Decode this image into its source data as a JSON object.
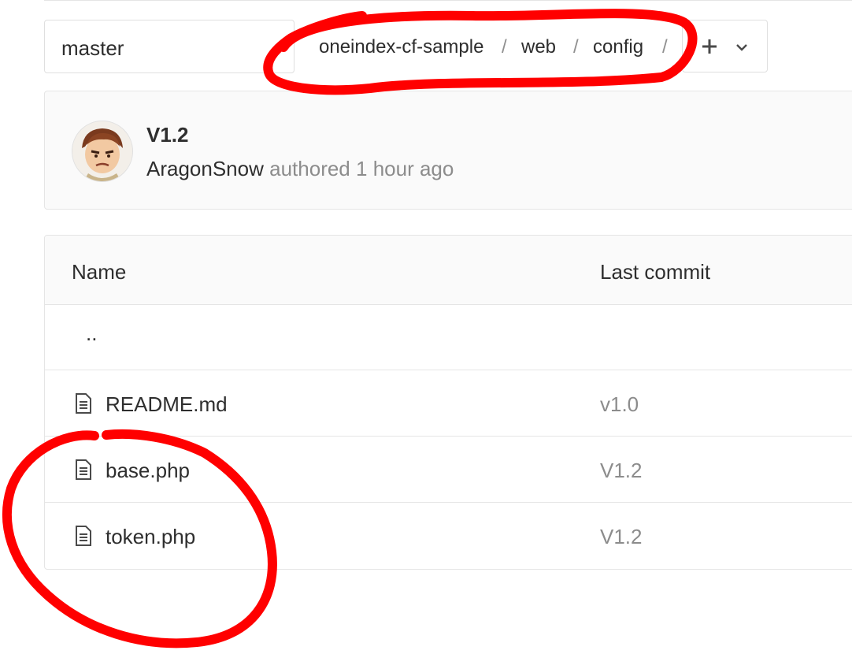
{
  "branch": {
    "name": "master"
  },
  "breadcrumb": {
    "items": [
      "oneindex-cf-sample",
      "web",
      "config"
    ],
    "separator": "/"
  },
  "add_menu": {
    "icon": "plus-icon",
    "chevron": "chevron-down-icon"
  },
  "last_commit": {
    "title": "V1.2",
    "author": "AragonSnow",
    "action": "authored",
    "time": "1 hour ago",
    "avatar_icon": "avatar"
  },
  "table": {
    "headers": {
      "name": "Name",
      "last_commit": "Last commit"
    },
    "parent_dir": "..",
    "files": [
      {
        "name": "README.md",
        "commit": "v1.0",
        "icon": "file-icon"
      },
      {
        "name": "base.php",
        "commit": "V1.2",
        "icon": "file-icon"
      },
      {
        "name": "token.php",
        "commit": "V1.2",
        "icon": "file-icon"
      }
    ]
  },
  "colors": {
    "annotation": "#ff0000",
    "border": "#e5e5e5",
    "muted_text": "#8c8c8c",
    "panel_bg": "#fafafa"
  }
}
